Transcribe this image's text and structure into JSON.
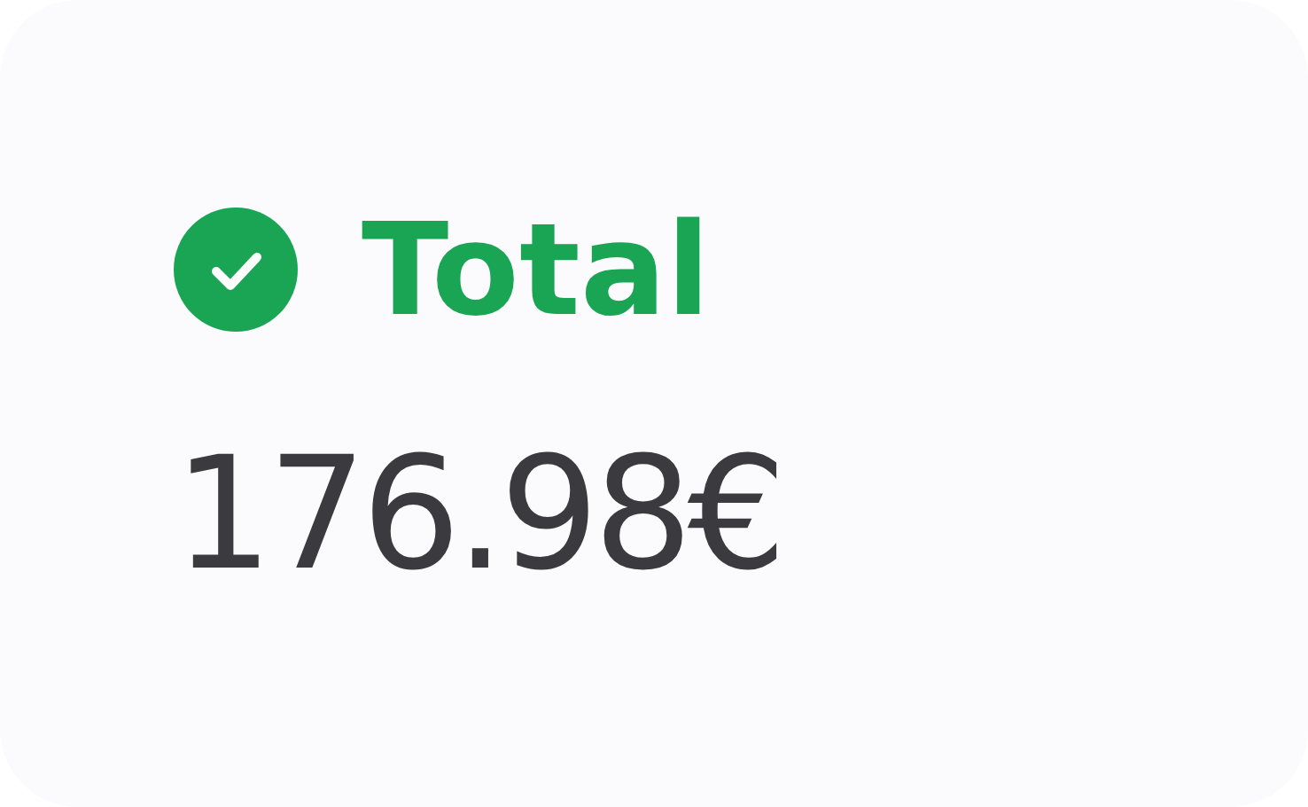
{
  "status": {
    "kind": "success",
    "label": "Total"
  },
  "amount": "176.98€"
}
